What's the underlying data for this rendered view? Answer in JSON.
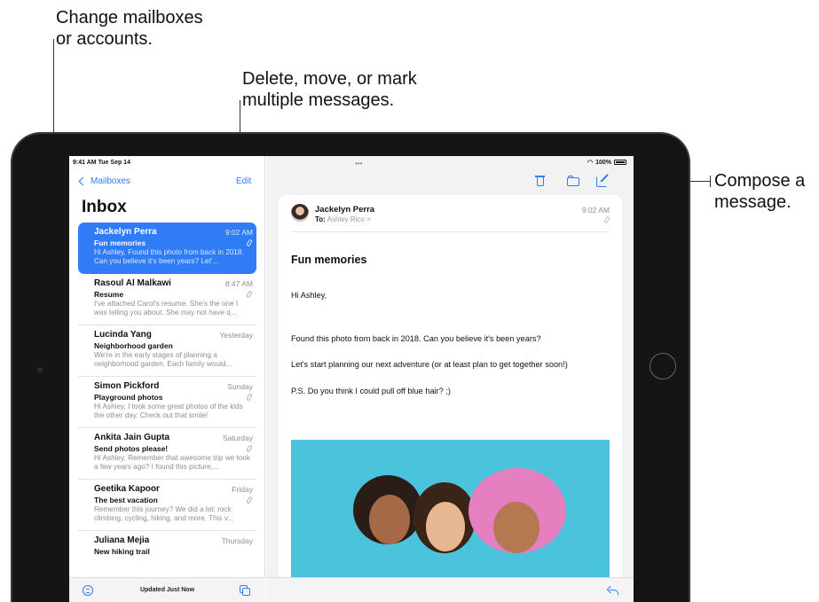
{
  "callouts": {
    "mailboxes": [
      "Change mailboxes",
      "or accounts."
    ],
    "edit": [
      "Delete, move, or mark",
      "multiple messages."
    ],
    "compose": [
      "Compose a",
      "message."
    ]
  },
  "status": {
    "time": "9:41 AM  Tue Sep 14",
    "battery": "100%"
  },
  "sidebar": {
    "back_label": "Mailboxes",
    "edit_label": "Edit",
    "title": "Inbox",
    "updated": "Updated Just Now",
    "messages": [
      {
        "sender": "Jackelyn Perra",
        "time": "9:02 AM",
        "subject": "Fun memories",
        "preview": "Hi Ashley, Found this photo from back in 2018. Can you believe it's been years? Let'..."
      },
      {
        "sender": "Rasoul Al Malkawi",
        "time": "8:47 AM",
        "subject": "Resume",
        "preview": "I've attached Carol's resume. She's the one I was telling you about. She may not have q..."
      },
      {
        "sender": "Lucinda Yang",
        "time": "Yesterday",
        "subject": "Neighborhood garden",
        "preview": "We're in the early stages of planning a neighborhood garden. Each family would..."
      },
      {
        "sender": "Simon Pickford",
        "time": "Sunday",
        "subject": "Playground photos",
        "preview": "Hi Ashley, I took some great photos of the kids the other day. Check out that smile!"
      },
      {
        "sender": "Ankita Jain Gupta",
        "time": "Saturday",
        "subject": "Send photos please!",
        "preview": "Hi Ashley, Remember that awesome trip we took a few years ago? I found this picture,..."
      },
      {
        "sender": "Geetika Kapoor",
        "time": "Friday",
        "subject": "The best vacation",
        "preview": "Remember this journey? We did a lot: rock climbing, cycling, hiking, and more. This v..."
      },
      {
        "sender": "Juliana Mejia",
        "time": "Thursday",
        "subject": "New hiking trail",
        "preview": ""
      }
    ]
  },
  "detail": {
    "from": "Jackelyn Perra",
    "to_label": "To:",
    "to": "Ashley Rico >",
    "time": "9:02 AM",
    "subject": "Fun memories",
    "greeting": "Hi Ashley,",
    "line1": "Found this photo from back in 2018. Can you believe it's been years?",
    "line2": "Let's start planning our next adventure (or at least plan to get together soon!)",
    "line3": "P.S. Do you think I could pull off blue hair? ;)"
  },
  "colors": {
    "accent": "#2f7cf6",
    "photo_bg": "#4cc3dd"
  }
}
